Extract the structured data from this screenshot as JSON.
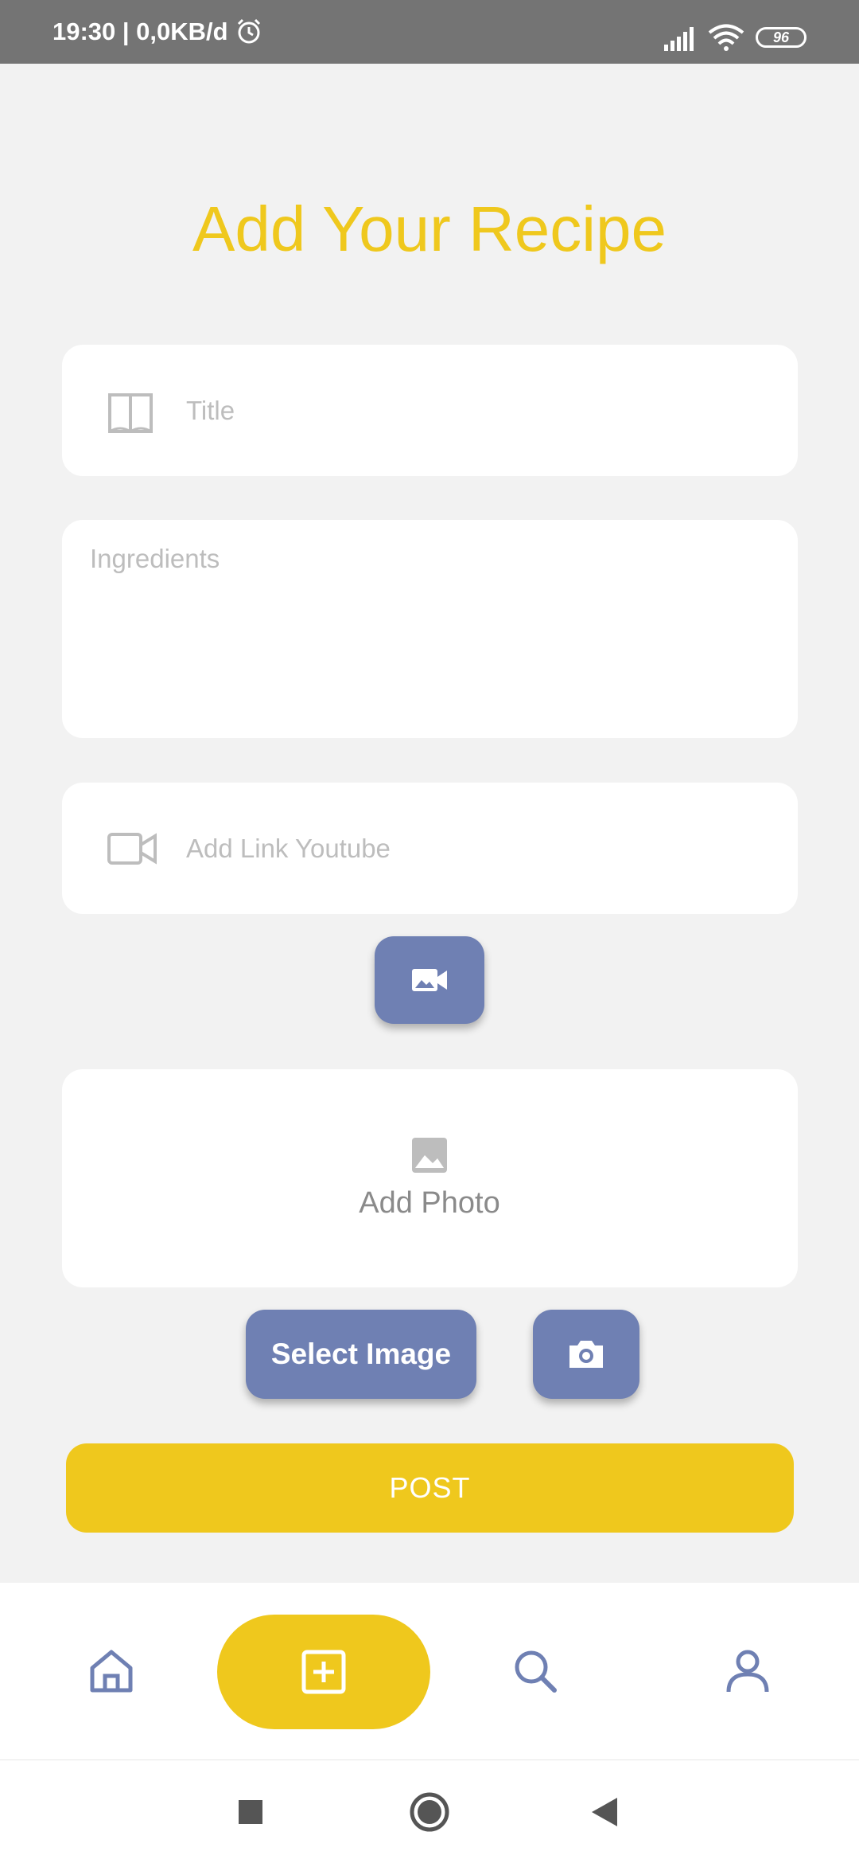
{
  "status_bar": {
    "time_speed": "19:30 | 0,0KB/d",
    "battery": "96"
  },
  "page": {
    "title": "Add Your Recipe"
  },
  "form": {
    "title_placeholder": "Title",
    "ingredients_placeholder": "Ingredients",
    "youtube_placeholder": "Add Link Youtube",
    "photo_label": "Add Photo",
    "select_image_label": "Select Image",
    "post_label": "POST"
  },
  "icons": {
    "title": "book-icon",
    "youtube": "video-camera-icon",
    "video_button": "video-gallery-icon",
    "photo": "image-icon",
    "camera": "camera-icon",
    "nav": [
      "home-icon",
      "add-square-icon",
      "search-icon",
      "user-icon"
    ]
  },
  "colors": {
    "accent_yellow": "#efc81d",
    "button_blue": "#6f80b3",
    "nav_icon_blue": "#6f80b3",
    "status_bar": "#747474",
    "background": "#f2f2f2"
  }
}
